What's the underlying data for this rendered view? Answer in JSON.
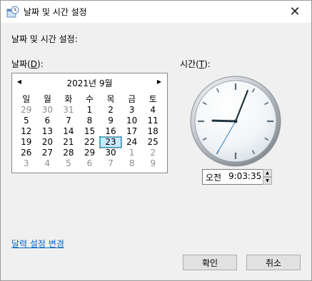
{
  "window": {
    "title": "날짜 및 시간 설정",
    "close_glyph": "✕"
  },
  "heading": "날짜 및 시간 설정:",
  "date_label": {
    "text": "날짜(",
    "mnemonic": "D",
    "suffix": "):"
  },
  "time_label": {
    "text": "시간(",
    "mnemonic": "T",
    "suffix": "):"
  },
  "calendar": {
    "month_title": "2021년 9월",
    "prev": "◀",
    "next": "▶",
    "weekdays": [
      "일",
      "월",
      "화",
      "수",
      "목",
      "금",
      "토"
    ],
    "weeks": [
      [
        "29",
        "30",
        "31",
        "1",
        "2",
        "3",
        "4"
      ],
      [
        "5",
        "6",
        "7",
        "8",
        "9",
        "10",
        "11"
      ],
      [
        "12",
        "13",
        "14",
        "15",
        "16",
        "17",
        "18"
      ],
      [
        "19",
        "20",
        "21",
        "22",
        "23",
        "24",
        "25"
      ],
      [
        "26",
        "27",
        "28",
        "29",
        "30",
        "1",
        "2"
      ],
      [
        "3",
        "4",
        "5",
        "6",
        "7",
        "8",
        "9"
      ]
    ],
    "selected_day": "23"
  },
  "clock": {
    "hour": 9,
    "minute": 3,
    "second": 35
  },
  "time_field": {
    "ampm": "오전",
    "value": "9:03:35"
  },
  "change_calendar_link": "달력 설정 변경",
  "buttons": {
    "ok": "확인",
    "cancel": "취소"
  }
}
